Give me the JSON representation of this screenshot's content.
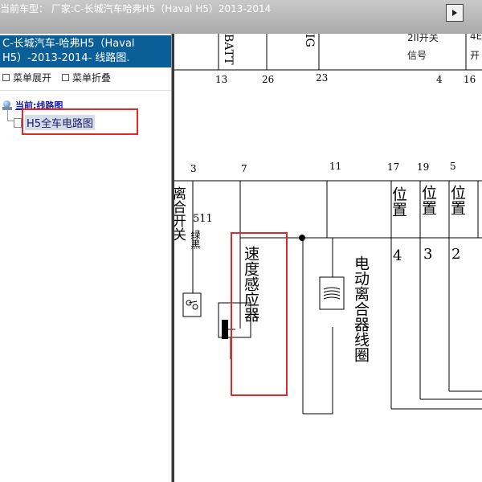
{
  "titlebar": {
    "title": "当前车型： 厂家:C-长城汽车哈弗H5（Haval H5）2013-2014"
  },
  "sidebar": {
    "model_header": "C-长城汽车-哈弗H5（Haval H5）-2013-2014- 线路图.",
    "menu_expand": "菜单展开",
    "menu_collapse": "菜单折叠",
    "tree_root": "当前:线路图",
    "tree_child": "H5全车电路图"
  },
  "diagram": {
    "top_labels": {
      "batt": "BATT",
      "ig": "IG",
      "switch_signal_1": "2II开关",
      "switch_signal_2": "信号",
      "right_partial_1": "4E",
      "right_partial_2": "开"
    },
    "top_pins": [
      "13",
      "26",
      "23",
      "4",
      "16"
    ],
    "mid_pins": [
      "3",
      "7",
      "11",
      "17",
      "19",
      "5"
    ],
    "clutch_switch": "离合开关",
    "wire_number": "511",
    "wire_color": "绿黑",
    "speed_sensor": "速度感应器",
    "clutch_solenoid": "电动离合器线圈",
    "positions": [
      {
        "label": "位置",
        "num": "4"
      },
      {
        "label": "位置",
        "num": "3"
      },
      {
        "label": "位置",
        "num": "2"
      }
    ]
  }
}
